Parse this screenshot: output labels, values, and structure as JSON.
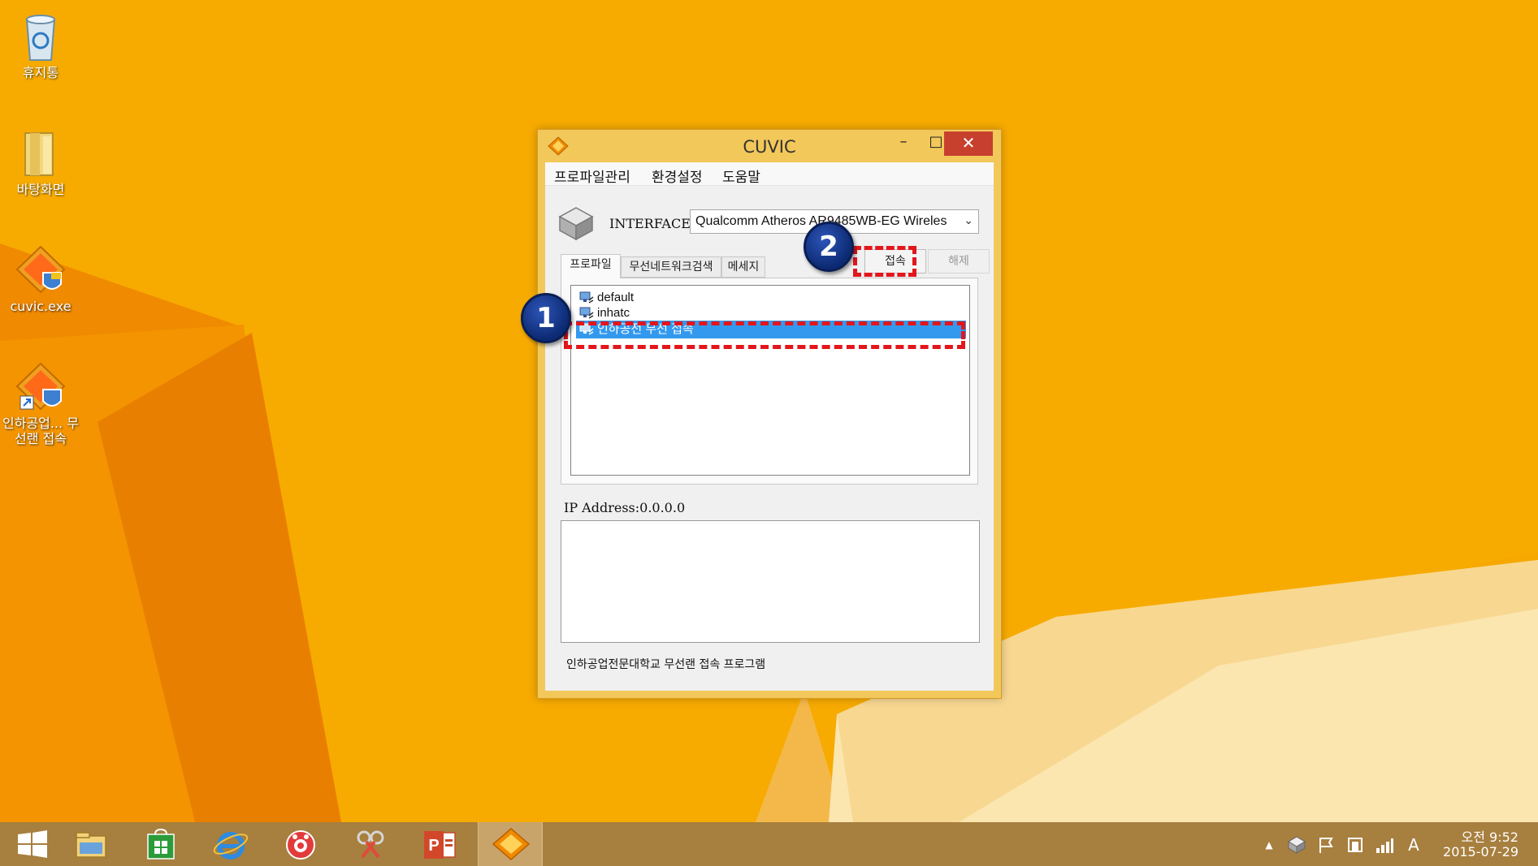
{
  "desktop": {
    "icons": [
      {
        "label": "휴지통",
        "icon": "recycle-bin-icon"
      },
      {
        "label": "바탕화면",
        "icon": "folder-icon"
      },
      {
        "label": "cuvic.exe",
        "icon": "cuvic-app-icon"
      },
      {
        "label": "인하공업... 무선랜 접속",
        "icon": "cuvic-shortcut-icon"
      }
    ]
  },
  "window": {
    "title": "CUVIC",
    "minimize": "–",
    "maximize": "□",
    "close": "✕",
    "menu": [
      "프로파일관리",
      "환경설정",
      "도움말"
    ],
    "interface_label": "INTERFACE",
    "interface_value": "Qualcomm Atheros AR9485WB-EG Wireles",
    "tabs": [
      "프로파일",
      "무선네트워크검색",
      "메세지"
    ],
    "connect_label": "접속",
    "disconnect_label": "해제",
    "profiles": [
      {
        "label": "default",
        "selected": false
      },
      {
        "label": "inhatc",
        "selected": false
      },
      {
        "label": "인하공전 무선 접속",
        "selected": true
      }
    ],
    "ip_address": "IP Address:0.0.0.0",
    "footer": "인하공업전문대학교 무선랜 접속 프로그램"
  },
  "annotations": {
    "badge1": "1",
    "badge2": "2",
    "color": "#e3161c"
  },
  "taskbar": {
    "apps": [
      "start-icon",
      "file-explorer-icon",
      "store-icon",
      "internet-explorer-icon",
      "camera-app-icon",
      "snipping-tool-icon",
      "powerpoint-icon",
      "cuvic-taskbar-icon"
    ],
    "tray": {
      "chevron": "▲",
      "ime": "A"
    },
    "clock_time": "오전 9:52",
    "clock_date": "2015-07-29"
  },
  "colors": {
    "desktop_bg": "#f6a800",
    "taskbar": "#a77f3e",
    "selection": "#3399ee",
    "close_button": "#c7402e"
  }
}
